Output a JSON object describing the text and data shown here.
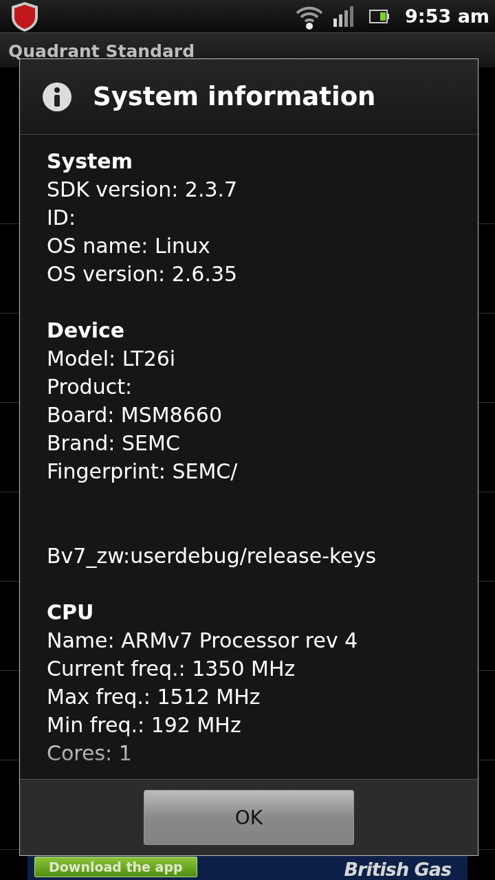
{
  "status_bar": {
    "time": "9:53 am"
  },
  "app_bar": {
    "title": "Quadrant Standard"
  },
  "dialog": {
    "title": "System information",
    "sections": [
      {
        "heading": "System",
        "lines": [
          {
            "kind": "line",
            "text": "SDK version: 2.3.7"
          },
          {
            "kind": "line",
            "text": "ID:"
          },
          {
            "kind": "line",
            "text": "OS name: Linux"
          },
          {
            "kind": "line",
            "text": "OS version: 2.6.35"
          }
        ]
      },
      {
        "heading": "Device",
        "lines": [
          {
            "kind": "line",
            "text": "Model: LT26i"
          },
          {
            "kind": "line",
            "text": "Product:"
          },
          {
            "kind": "line",
            "text": "Board: MSM8660"
          },
          {
            "kind": "line",
            "text": "Brand: SEMC"
          },
          {
            "kind": "line",
            "text": "Fingerprint: SEMC/"
          },
          {
            "kind": "continuation",
            "text": "Bv7_zw:userdebug/release-keys"
          }
        ]
      },
      {
        "heading": "CPU",
        "lines": [
          {
            "kind": "line",
            "text": "Name: ARMv7 Processor rev 4"
          },
          {
            "kind": "line",
            "text": "Current freq.: 1350 MHz"
          },
          {
            "kind": "line",
            "text": "Max freq.: 1512 MHz"
          },
          {
            "kind": "line",
            "text": "Min freq.: 192 MHz"
          },
          {
            "kind": "line",
            "text": "Cores: 1"
          }
        ]
      }
    ],
    "buttons": [
      "OK"
    ]
  },
  "ad": {
    "button": "Download the app",
    "brand": "British Gas"
  }
}
